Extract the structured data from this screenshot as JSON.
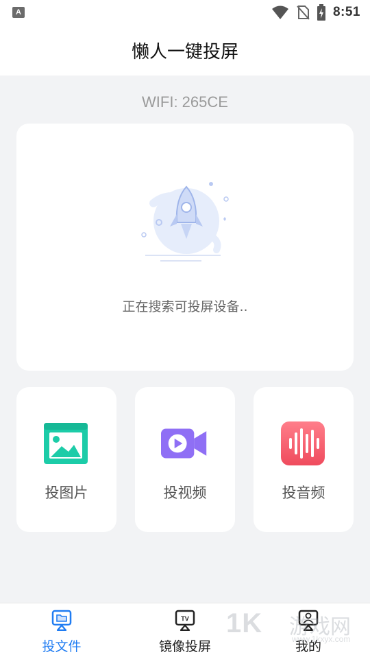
{
  "status_bar": {
    "time": "8:51",
    "icons": [
      "text-input-icon",
      "wifi-icon",
      "no-sim-icon",
      "battery-charging-icon"
    ]
  },
  "header": {
    "title": "懒人一键投屏"
  },
  "wifi_label": "WIFI: 265CE",
  "search_card": {
    "status_text": "正在搜索可投屏设备..",
    "illustration": "rocket-icon"
  },
  "tiles": [
    {
      "label": "投图片",
      "icon": "image-icon",
      "color": "#1ccca8"
    },
    {
      "label": "投视频",
      "icon": "video-camera-icon",
      "color": "#8f6ff5"
    },
    {
      "label": "投音频",
      "icon": "audio-waveform-icon",
      "color": "#f05a6a"
    }
  ],
  "bottom_nav": [
    {
      "label": "投文件",
      "icon": "cast-file-icon",
      "active": true
    },
    {
      "label": "镜像投屏",
      "icon": "tv-mirror-icon",
      "active": false
    },
    {
      "label": "我的",
      "icon": "profile-icon",
      "active": false
    }
  ],
  "theme": {
    "accent": "#1f7cf2",
    "background": "#f2f3f5"
  },
  "watermark": {
    "mark": "1K",
    "cn": "游戏网",
    "url": "www.1kxyx.com"
  }
}
